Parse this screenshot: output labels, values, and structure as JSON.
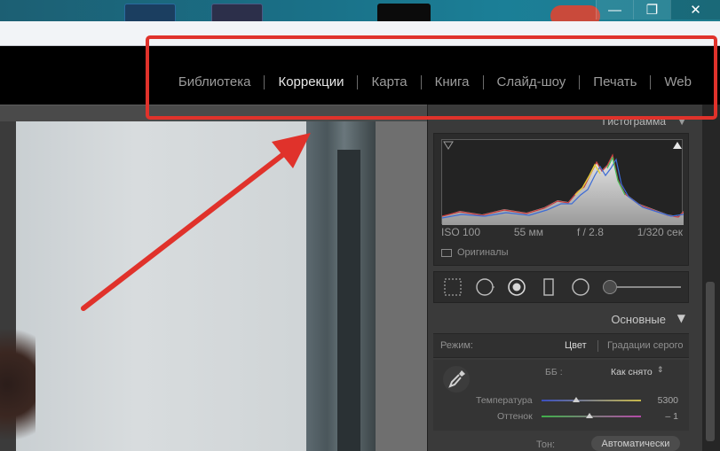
{
  "window": {
    "minimize_glyph": "—",
    "maximize_glyph": "❐",
    "close_glyph": "✕"
  },
  "modules": [
    {
      "label": "Библиотека",
      "active": false
    },
    {
      "label": "Коррекции",
      "active": true
    },
    {
      "label": "Карта",
      "active": false
    },
    {
      "label": "Книга",
      "active": false
    },
    {
      "label": "Слайд-шоу",
      "active": false
    },
    {
      "label": "Печать",
      "active": false
    },
    {
      "label": "Web",
      "active": false
    }
  ],
  "histogram": {
    "title": "Гистограмма",
    "iso": "ISO 100",
    "focal": "55 мм",
    "aperture": "f / 2.8",
    "shutter": "1/320 сек",
    "originals_label": "Оригиналы"
  },
  "basic": {
    "title": "Основные",
    "mode_label": "Режим:",
    "mode_color": "Цвет",
    "mode_gray": "Градации серого",
    "wb_label": "ББ :",
    "wb_value": "Как снято",
    "wb_arrows": "⇕",
    "temp_label": "Температура",
    "temp_value": "5300",
    "temp_fraction": 0.35,
    "tint_label": "Оттенок",
    "tint_value": "– 1",
    "tint_fraction": 0.48,
    "tone_label": "Тон:",
    "tone_auto": "Автоматически"
  },
  "colors": {
    "annotation_red": "#e0322b",
    "panel_bg": "#3a3a3a"
  }
}
